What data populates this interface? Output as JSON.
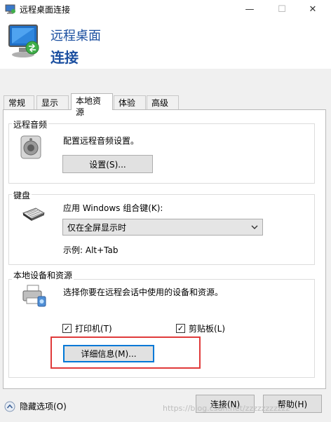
{
  "window": {
    "title": "远程桌面连接",
    "minimize_glyph": "—",
    "maximize_glyph": "☐",
    "close_glyph": "✕"
  },
  "header": {
    "line1": "远程桌面",
    "line2": "连接"
  },
  "tabs": [
    {
      "label": "常规"
    },
    {
      "label": "显示"
    },
    {
      "label": "本地资源",
      "active": true
    },
    {
      "label": "体验"
    },
    {
      "label": "高级"
    }
  ],
  "audio": {
    "title": "远程音频",
    "description": "配置远程音频设置。",
    "settings_button": "设置(S)..."
  },
  "keyboard": {
    "title": "键盘",
    "label": "应用 Windows 组合键(K):",
    "selected": "仅在全屏显示时",
    "example": "示例: Alt+Tab"
  },
  "devices": {
    "title": "本地设备和资源",
    "description": "选择你要在远程会话中使用的设备和资源。",
    "printer_label": "打印机(T)",
    "printer_checked": true,
    "clipboard_label": "剪贴板(L)",
    "clipboard_checked": true,
    "details_button": "详细信息(M)..."
  },
  "footer": {
    "hide_options": "隐藏选项(O)",
    "connect_button": "连接(N)",
    "help_button": "帮助(H)",
    "watermark": "https://blog.csdn.net/zzzzzzzzzzz"
  },
  "colors": {
    "title_blue": "#1b4fa0",
    "highlight_red": "#e03a3a",
    "focus_blue": "#0078d7"
  }
}
